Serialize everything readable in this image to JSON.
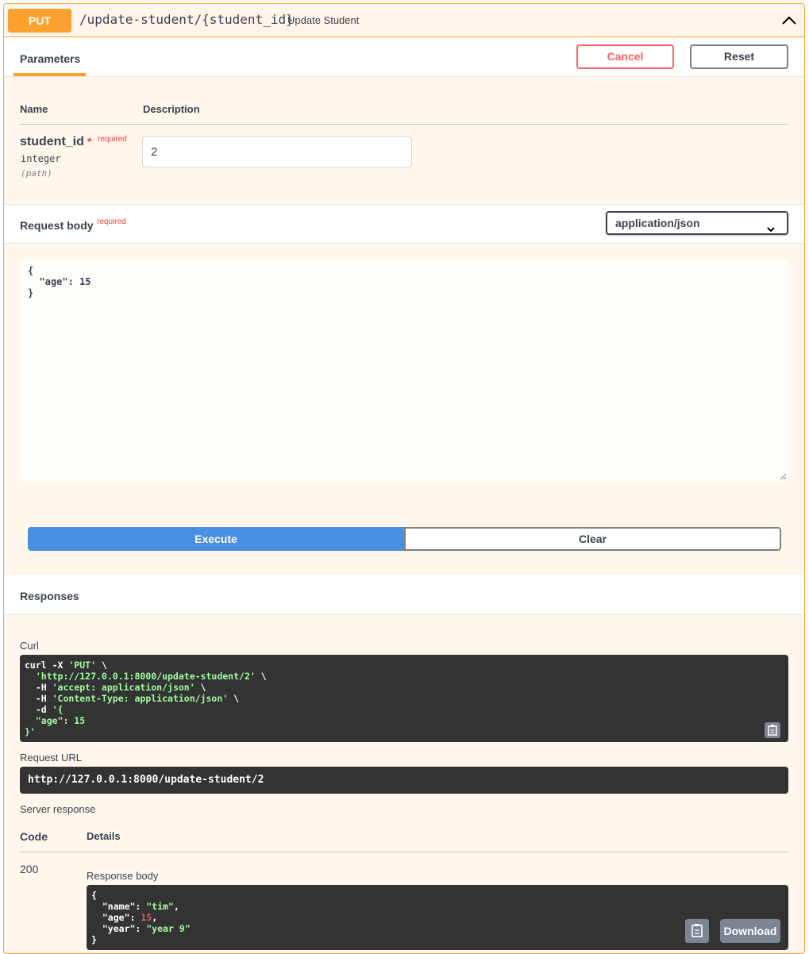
{
  "operation": {
    "method": "PUT",
    "path": "/update-student/{student_id}",
    "summary": "Update Student"
  },
  "parameters": {
    "tab_label": "Parameters",
    "cancel_label": "Cancel",
    "reset_label": "Reset",
    "col_name": "Name",
    "col_description": "Description",
    "param": {
      "name": "student_id",
      "required_star": "*",
      "required_text": "required",
      "type": "integer",
      "in": "(path)",
      "value": "2"
    }
  },
  "request_body": {
    "title": "Request body",
    "required_text": "required",
    "content_type": "application/json",
    "json_lines": [
      "{",
      "  \"age\": 15",
      "}"
    ]
  },
  "actions": {
    "execute_label": "Execute",
    "clear_label": "Clear"
  },
  "responses": {
    "title": "Responses",
    "curl_label": "Curl",
    "curl": {
      "line1_cmd": "curl -X ",
      "line1_method": "'PUT'",
      "line1_tail": " \\",
      "line2_url": "  'http://127.0.0.1:8000/update-student/2'",
      "line2_tail": " \\",
      "line3_flag": "  -H ",
      "line3_val": "'accept: application/json'",
      "line3_tail": " \\",
      "line4_flag": "  -H ",
      "line4_val": "'Content-Type: application/json'",
      "line4_tail": " \\",
      "line5_flag": "  -d ",
      "line5_val": "'{",
      "line6": "  \"age\": 15",
      "line7": "}'"
    },
    "request_url_label": "Request URL",
    "request_url": "http://127.0.0.1:8000/update-student/2",
    "server_response_label": "Server response",
    "col_code": "Code",
    "col_details": "Details",
    "code": "200",
    "response_body_label": "Response body",
    "response_body": {
      "open": "{",
      "name_key": "  \"name\"",
      "name_val": "\"tim\"",
      "age_key": "  \"age\"",
      "age_val": "15",
      "year_key": "  \"year\"",
      "year_val": "\"year 9\"",
      "close": "}"
    },
    "download_label": "Download"
  },
  "colors": {
    "put_accent": "#fca130",
    "execute_blue": "#4990e2",
    "cancel_red": "#ff6060",
    "code_bg": "#333333",
    "string_green": "#a2fca2",
    "number_red": "#d36363"
  },
  "icons": {
    "collapse": "chevron-up-icon",
    "select": "chevron-down-icon",
    "copy": "clipboard-icon"
  }
}
